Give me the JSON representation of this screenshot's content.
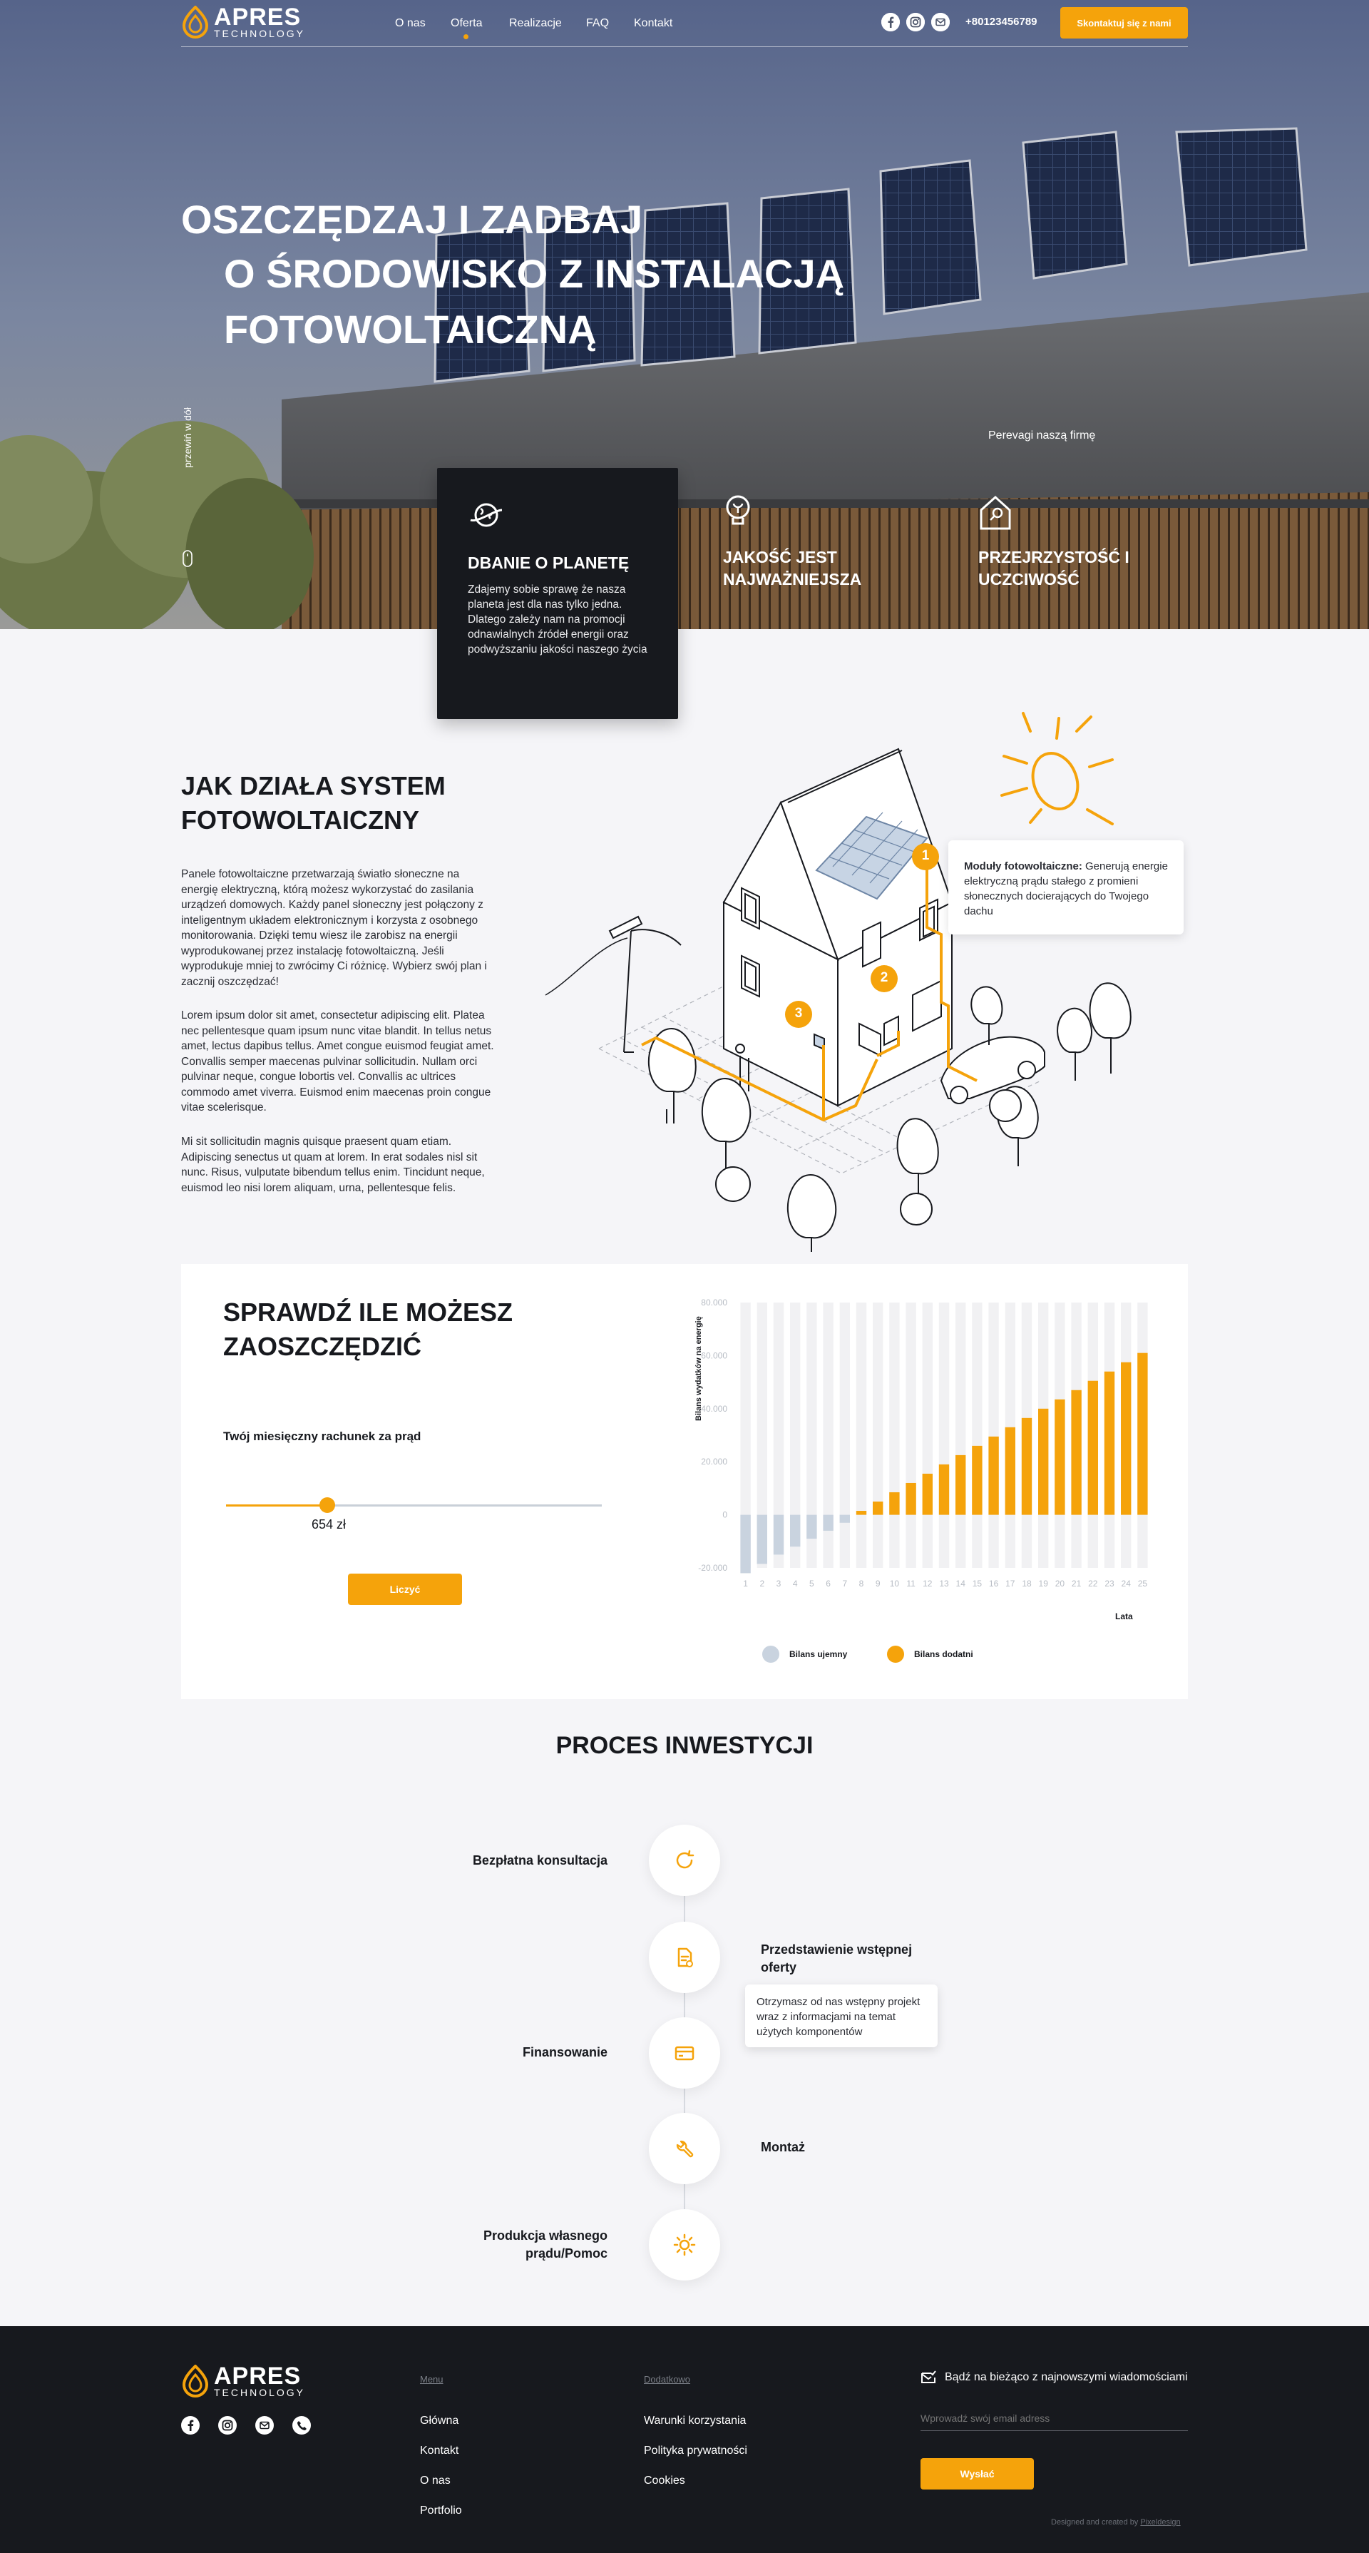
{
  "nav": {
    "logo_name": "APRES",
    "logo_sub": "TECHNOLOGY",
    "items": [
      "O nas",
      "Oferta",
      "Realizacje",
      "FAQ",
      "Kontakt"
    ],
    "active_index": 1,
    "phone": "+80123456789",
    "cta": "Skontaktuj się z nami",
    "social_icons": [
      "facebook-icon",
      "instagram-icon",
      "email-icon"
    ]
  },
  "hero": {
    "title_line1": "OSZCZĘDZAJ I ZADBAJ",
    "title_line2": "O ŚRODOWISKO Z INSTALACJĄ",
    "title_line3": "FOTOWOLTAICZNĄ",
    "scroll_hint": "przewiń w dół",
    "company_label": "Perevagi naszą firmę",
    "features": [
      {
        "icon": "planet-icon",
        "title": "DBANIE O PLANETĘ",
        "text": "Zdajemy sobie sprawę że nasza planeta jest dla nas tylko jedna. Dlatego zależy nam na promocji odnawialnych źródeł energii oraz podwyższaniu jakości naszego życia"
      },
      {
        "icon": "bulb-icon",
        "title": "JAKOŚĆ JEST NAJWAŻNIEJSZA",
        "text": ""
      },
      {
        "icon": "house-key-icon",
        "title": "PRZEJRZYSTOŚĆ I UCZCIWOŚĆ",
        "text": ""
      }
    ]
  },
  "how": {
    "title": "JAK DZIAŁA SYSTEM FOTOWOLTAICZNY",
    "paragraphs": [
      "Panele fotowoltaiczne przetwarzają światło słoneczne na energię elektryczną, którą możesz wykorzystać do zasilania urządzeń domowych. Każdy panel słoneczny jest połączony z inteligentnym układem elektronicznym i korzysta z osobnego monitorowania. Dzięki temu wiesz ile zarobisz na energii wyprodukowanej przez instalację fotowoltaiczną. Jeśli wyprodukuje mniej to zwrócimy Ci różnicę. Wybierz swój plan i zacznij oszczędzać!",
      "Lorem ipsum dolor sit amet, consectetur adipiscing elit. Platea nec pellentesque quam ipsum nunc vitae blandit. In tellus netus amet, lectus dapibus tellus. Amet congue euismod feugiat amet. Convallis semper maecenas pulvinar sollicitudin. Nullam orci pulvinar neque, congue lobortis vel. Convallis ac ultrices commodo amet viverra. Euismod enim maecenas proin congue vitae scelerisque.",
      "Mi sit sollicitudin magnis quisque praesent quam etiam. Adipiscing senectus ut quam at lorem. In erat sodales nisl sit nunc. Risus, vulputate bibendum tellus enim. Tincidunt neque, euismod leo nisi lorem aliquam, urna, pellentesque felis."
    ],
    "markers": [
      "1",
      "2",
      "3"
    ],
    "tooltip_bold": "Moduły fotowoltaiczne:",
    "tooltip_text": " Generują energie elektryczną prądu stałego z promieni słonecznych docierających do Twojego dachu"
  },
  "calc": {
    "title": "SPRAWDŹ ILE MOŻESZ ZAOSZCZĘDZIĆ",
    "label": "Twój miesięczny rachunek za prąd",
    "value": "654 zł",
    "slider_fraction": 0.27,
    "button": "Liczyć",
    "legend_negative": "Bilans ujemny",
    "legend_positive": "Bilans dodatni"
  },
  "chart_data": {
    "type": "bar",
    "ylabel": "Bilans wydatków na energię",
    "xlabel": "Lata",
    "ylim": [
      -20000,
      80000
    ],
    "yticks": [
      "80.000",
      "60.000",
      "40.000",
      "20.000",
      "0",
      "-20.000"
    ],
    "categories": [
      "1",
      "2",
      "3",
      "4",
      "5",
      "6",
      "7",
      "8",
      "9",
      "10",
      "11",
      "12",
      "13",
      "14",
      "15",
      "16",
      "17",
      "18",
      "19",
      "20",
      "21",
      "22",
      "23",
      "24",
      "25"
    ],
    "values": [
      -22000,
      -18500,
      -15000,
      -12000,
      -9000,
      -6000,
      -3000,
      1500,
      5000,
      8500,
      12000,
      15500,
      19000,
      22500,
      26000,
      29500,
      33000,
      36500,
      40000,
      43500,
      47000,
      50500,
      54000,
      57500,
      61000
    ],
    "colors": {
      "negative": "#c9d3df",
      "positive": "#f5a30b",
      "track": "#f1f1f3"
    }
  },
  "process": {
    "title": "PROCES INWESTYCJI",
    "steps": [
      {
        "label": "Bezpłatna konsultacja",
        "icon": "refresh-icon",
        "side": "left"
      },
      {
        "label": "Przedstawienie wstępnej oferty",
        "icon": "document-icon",
        "side": "right",
        "note": "Otrzymasz od nas wstępny projekt wraz z informacjami na temat użytych komponentów"
      },
      {
        "label": "Finansowanie",
        "icon": "card-icon",
        "side": "left"
      },
      {
        "label": "Montaż",
        "icon": "wrench-icon",
        "side": "right"
      },
      {
        "label": "Produkcja własnego prądu/Pomoc",
        "icon": "sun-icon",
        "side": "left"
      }
    ]
  },
  "footer": {
    "logo_name": "APRES",
    "logo_sub": "TECHNOLOGY",
    "menu_title": "Menu",
    "menu": [
      "Główna",
      "Kontakt",
      "O nas",
      "Portfolio"
    ],
    "extra_title": "Dodatkowo",
    "extra": [
      "Warunki korzystania",
      "Polityka prywatności",
      "Cookies"
    ],
    "newsletter": "Bądź na bieżąco z najnowszymi wiadomościami",
    "email_placeholder": "Wprowadź swój email adress",
    "send": "Wysłać",
    "credit_prefix": "Designed and created by ",
    "credit_link": "Pixeldesign"
  },
  "colors": {
    "accent": "#f5a30b",
    "dark": "#17191e",
    "bg": "#f5f5f8"
  }
}
